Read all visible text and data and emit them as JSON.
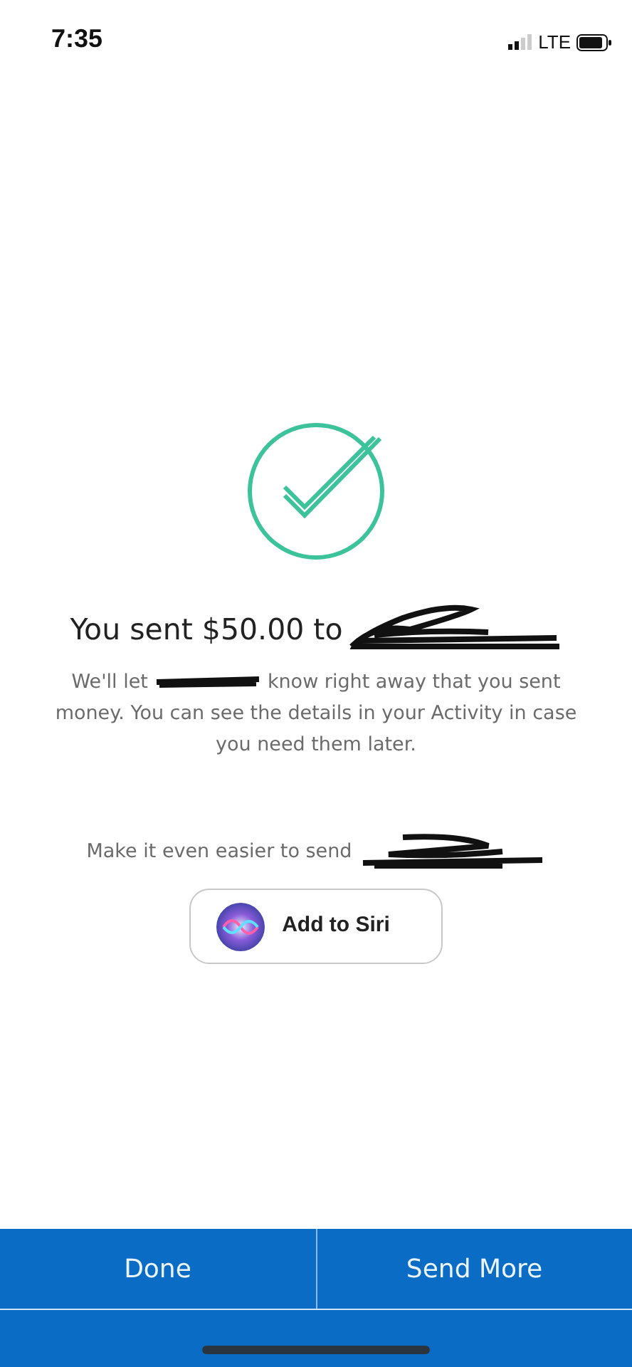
{
  "status_bar": {
    "time": "7:35",
    "network": "LTE"
  },
  "confirmation": {
    "title": "You sent $50.00 to",
    "message_start": "We'll let",
    "message_end": "know right away that you sent",
    "message_rest": "money. You can see the details in your Activity in case you need them later."
  },
  "siri": {
    "prompt": "Make it even easier to send",
    "button": "Add to Siri"
  },
  "footer_buttons": [
    "Done",
    "Send More"
  ]
}
